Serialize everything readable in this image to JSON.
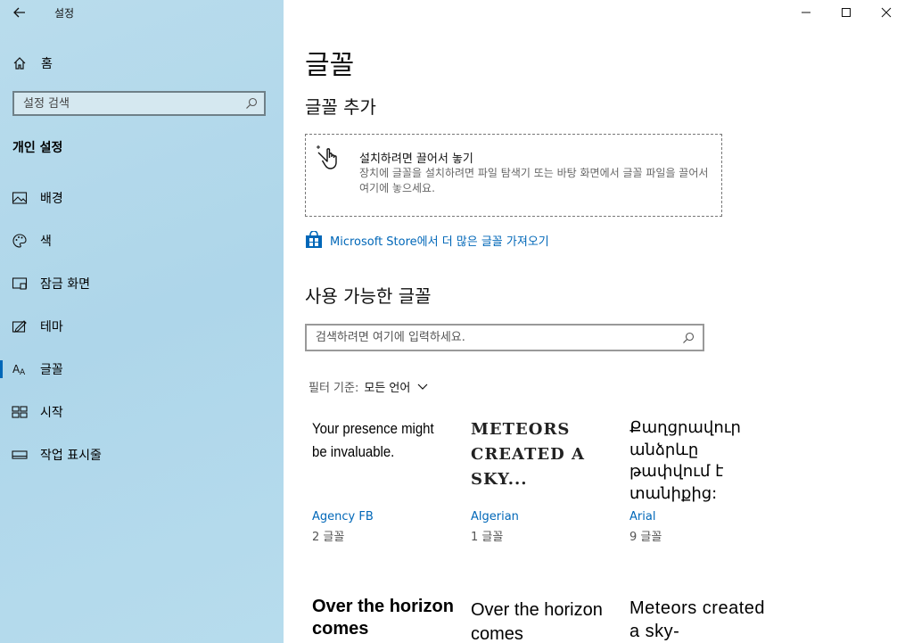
{
  "window": {
    "title": "설정",
    "minimize_glyph": "─",
    "maximize_glyph": "☐",
    "close_glyph": "✕"
  },
  "sidebar": {
    "home_label": "홈",
    "search_placeholder": "설정 검색",
    "section_title": "개인 설정",
    "items": [
      {
        "label": "배경",
        "icon": "picture-icon"
      },
      {
        "label": "색",
        "icon": "palette-icon"
      },
      {
        "label": "잠금 화면",
        "icon": "lock-screen-icon"
      },
      {
        "label": "테마",
        "icon": "theme-brush-icon"
      },
      {
        "label": "글꼴",
        "icon": "font-icon",
        "active": true
      },
      {
        "label": "시작",
        "icon": "start-menu-icon"
      },
      {
        "label": "작업 표시줄",
        "icon": "taskbar-icon"
      }
    ]
  },
  "main": {
    "title": "글꼴",
    "add_title": "글꼴 추가",
    "dropzone": {
      "title": "설치하려면 끌어서 놓기",
      "description": "장치에 글꼴을 설치하려면 파일 탐색기 또는 바탕 화면에서 글꼴 파일을 끌어서 여기에 놓으세요."
    },
    "store_link": "Microsoft Store에서 더 많은 글꼴 가져오기",
    "available_title": "사용 가능한 글꼴",
    "search_placeholder": "검색하려면 여기에 입력하세요.",
    "filter_label": "필터 기준:",
    "filter_value": "모든 언어",
    "fonts": [
      {
        "sample": "Your presence might be invaluable.",
        "name": "Agency FB",
        "count": "2 글꼴"
      },
      {
        "sample": "METEORS CREATED A SKY...",
        "name": "Algerian",
        "count": "1 글꼴"
      },
      {
        "sample": "Քաղցրավուր անձրևը թափվում է տանիքից:",
        "name": "Arial",
        "count": "9 글꼴"
      },
      {
        "sample": "Over the horizon comes",
        "name": "",
        "count": ""
      },
      {
        "sample": "Over the horizon comes",
        "name": "",
        "count": ""
      },
      {
        "sample": "Meteors created a sky-",
        "name": "",
        "count": ""
      }
    ]
  },
  "colors": {
    "accent": "#0067b8",
    "sidebar_bg": "#b3d9ec"
  }
}
